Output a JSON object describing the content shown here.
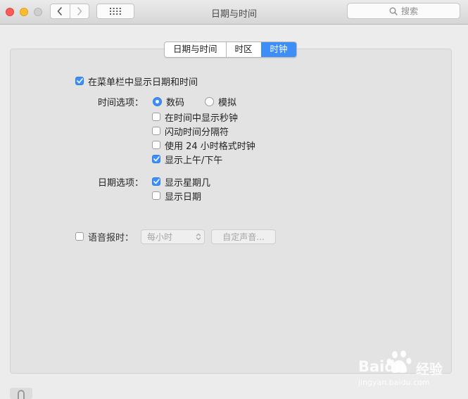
{
  "window": {
    "title": "日期与时间"
  },
  "toolbar": {
    "search_placeholder": "搜索",
    "back_icon": "chevron-left-icon",
    "forward_icon": "chevron-right-icon",
    "grid_icon": "show-all-grid-icon"
  },
  "tabs": [
    {
      "label": "日期与时间",
      "active": false
    },
    {
      "label": "时区",
      "active": false
    },
    {
      "label": "时钟",
      "active": true
    }
  ],
  "clock": {
    "show_in_menubar": {
      "label": "在菜单栏中显示日期和时间",
      "checked": true
    },
    "time_options": {
      "label": "时间选项：",
      "digital": {
        "label": "数码",
        "selected": true
      },
      "analog": {
        "label": "模拟",
        "selected": false
      },
      "show_seconds": {
        "label": "在时间中显示秒钟",
        "checked": false
      },
      "flash_separators": {
        "label": "闪动时间分隔符",
        "checked": false
      },
      "use_24h": {
        "label": "使用 24 小时格式时钟",
        "checked": false
      },
      "show_ampm": {
        "label": "显示上午/下午",
        "checked": true
      }
    },
    "date_options": {
      "label": "日期选项：",
      "show_weekday": {
        "label": "显示星期几",
        "checked": true
      },
      "show_date": {
        "label": "显示日期",
        "checked": false
      }
    },
    "announce": {
      "label": "语音报时：",
      "checked": false,
      "interval_value": "每小时",
      "customize_voice_label": "自定声音..."
    }
  },
  "watermark": {
    "brand": "Baidu",
    "brand_cn": "经验",
    "site": "jingyan.baidu.com"
  },
  "colors": {
    "accent": "#3d8ff7",
    "close": "#fc5b57",
    "minimize": "#fdbc2e"
  }
}
